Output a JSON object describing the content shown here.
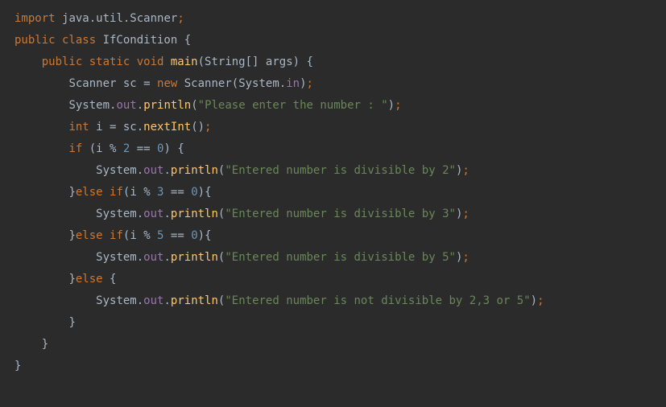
{
  "code": {
    "lines": [
      {
        "indent": 0,
        "tokens": [
          {
            "t": "import ",
            "c": "kw"
          },
          {
            "t": "java.util.Scanner",
            "c": "pkg"
          },
          {
            "t": ";",
            "c": "semi"
          }
        ]
      },
      {
        "indent": 0,
        "tokens": [
          {
            "t": "public class ",
            "c": "kw"
          },
          {
            "t": "IfCondition ",
            "c": "cls"
          },
          {
            "t": "{",
            "c": "brace"
          }
        ]
      },
      {
        "indent": 1,
        "tokens": [
          {
            "t": "public static void ",
            "c": "kw"
          },
          {
            "t": "main",
            "c": "method"
          },
          {
            "t": "(",
            "c": "paren"
          },
          {
            "t": "String",
            "c": "cls"
          },
          {
            "t": "[] ",
            "c": "paren"
          },
          {
            "t": "args",
            "c": "ident"
          },
          {
            "t": ") ",
            "c": "paren"
          },
          {
            "t": "{",
            "c": "brace"
          }
        ]
      },
      {
        "indent": 2,
        "tokens": [
          {
            "t": "Scanner ",
            "c": "cls"
          },
          {
            "t": "sc ",
            "c": "ident"
          },
          {
            "t": "= ",
            "c": "op"
          },
          {
            "t": "new ",
            "c": "kw"
          },
          {
            "t": "Scanner",
            "c": "cls"
          },
          {
            "t": "(",
            "c": "paren"
          },
          {
            "t": "System",
            "c": "cls"
          },
          {
            "t": ".",
            "c": "op"
          },
          {
            "t": "in",
            "c": "field"
          },
          {
            "t": ")",
            "c": "paren"
          },
          {
            "t": ";",
            "c": "semi"
          }
        ]
      },
      {
        "indent": 2,
        "tokens": [
          {
            "t": "System",
            "c": "cls"
          },
          {
            "t": ".",
            "c": "op"
          },
          {
            "t": "out",
            "c": "field"
          },
          {
            "t": ".",
            "c": "op"
          },
          {
            "t": "println",
            "c": "method"
          },
          {
            "t": "(",
            "c": "paren"
          },
          {
            "t": "\"Please enter the number : \"",
            "c": "str"
          },
          {
            "t": ")",
            "c": "paren"
          },
          {
            "t": ";",
            "c": "semi"
          }
        ]
      },
      {
        "indent": 2,
        "tokens": [
          {
            "t": "int ",
            "c": "kw"
          },
          {
            "t": "i ",
            "c": "ident"
          },
          {
            "t": "= ",
            "c": "op"
          },
          {
            "t": "sc",
            "c": "ident"
          },
          {
            "t": ".",
            "c": "op"
          },
          {
            "t": "nextInt",
            "c": "method"
          },
          {
            "t": "()",
            "c": "paren"
          },
          {
            "t": ";",
            "c": "semi"
          }
        ]
      },
      {
        "indent": 2,
        "tokens": [
          {
            "t": "if ",
            "c": "kw"
          },
          {
            "t": "(",
            "c": "paren"
          },
          {
            "t": "i ",
            "c": "ident"
          },
          {
            "t": "% ",
            "c": "op"
          },
          {
            "t": "2",
            "c": "num"
          },
          {
            "t": " == ",
            "c": "op"
          },
          {
            "t": "0",
            "c": "num"
          },
          {
            "t": ") ",
            "c": "paren"
          },
          {
            "t": "{",
            "c": "brace"
          }
        ]
      },
      {
        "indent": 3,
        "tokens": [
          {
            "t": "System",
            "c": "cls"
          },
          {
            "t": ".",
            "c": "op"
          },
          {
            "t": "out",
            "c": "field"
          },
          {
            "t": ".",
            "c": "op"
          },
          {
            "t": "println",
            "c": "method"
          },
          {
            "t": "(",
            "c": "paren"
          },
          {
            "t": "\"Entered number is divisible by 2\"",
            "c": "str"
          },
          {
            "t": ")",
            "c": "paren"
          },
          {
            "t": ";",
            "c": "semi"
          }
        ]
      },
      {
        "indent": 2,
        "tokens": [
          {
            "t": "}",
            "c": "brace"
          },
          {
            "t": "else if",
            "c": "kw"
          },
          {
            "t": "(",
            "c": "paren"
          },
          {
            "t": "i ",
            "c": "ident"
          },
          {
            "t": "% ",
            "c": "op"
          },
          {
            "t": "3",
            "c": "num"
          },
          {
            "t": " == ",
            "c": "op"
          },
          {
            "t": "0",
            "c": "num"
          },
          {
            "t": ")",
            "c": "paren"
          },
          {
            "t": "{",
            "c": "brace"
          }
        ]
      },
      {
        "indent": 3,
        "tokens": [
          {
            "t": "System",
            "c": "cls"
          },
          {
            "t": ".",
            "c": "op"
          },
          {
            "t": "out",
            "c": "field"
          },
          {
            "t": ".",
            "c": "op"
          },
          {
            "t": "println",
            "c": "method"
          },
          {
            "t": "(",
            "c": "paren"
          },
          {
            "t": "\"Entered number is divisible by 3\"",
            "c": "str"
          },
          {
            "t": ")",
            "c": "paren"
          },
          {
            "t": ";",
            "c": "semi"
          }
        ]
      },
      {
        "indent": 2,
        "tokens": [
          {
            "t": "}",
            "c": "brace"
          },
          {
            "t": "else if",
            "c": "kw"
          },
          {
            "t": "(",
            "c": "paren"
          },
          {
            "t": "i ",
            "c": "ident"
          },
          {
            "t": "% ",
            "c": "op"
          },
          {
            "t": "5",
            "c": "num"
          },
          {
            "t": " == ",
            "c": "op"
          },
          {
            "t": "0",
            "c": "num"
          },
          {
            "t": ")",
            "c": "paren"
          },
          {
            "t": "{",
            "c": "brace"
          }
        ]
      },
      {
        "indent": 3,
        "tokens": [
          {
            "t": "System",
            "c": "cls"
          },
          {
            "t": ".",
            "c": "op"
          },
          {
            "t": "out",
            "c": "field"
          },
          {
            "t": ".",
            "c": "op"
          },
          {
            "t": "println",
            "c": "method"
          },
          {
            "t": "(",
            "c": "paren"
          },
          {
            "t": "\"Entered number is divisible by 5\"",
            "c": "str"
          },
          {
            "t": ")",
            "c": "paren"
          },
          {
            "t": ";",
            "c": "semi"
          }
        ]
      },
      {
        "indent": 2,
        "tokens": [
          {
            "t": "}",
            "c": "brace"
          },
          {
            "t": "else ",
            "c": "kw"
          },
          {
            "t": "{",
            "c": "brace"
          }
        ]
      },
      {
        "indent": 3,
        "tokens": [
          {
            "t": "System",
            "c": "cls"
          },
          {
            "t": ".",
            "c": "op"
          },
          {
            "t": "out",
            "c": "field"
          },
          {
            "t": ".",
            "c": "op"
          },
          {
            "t": "println",
            "c": "method"
          },
          {
            "t": "(",
            "c": "paren"
          },
          {
            "t": "\"Entered number is not divisible by 2,3 or 5\"",
            "c": "str"
          },
          {
            "t": ")",
            "c": "paren"
          },
          {
            "t": ";",
            "c": "semi"
          }
        ]
      },
      {
        "indent": 2,
        "tokens": [
          {
            "t": "}",
            "c": "brace"
          }
        ]
      },
      {
        "indent": 1,
        "tokens": [
          {
            "t": "}",
            "c": "brace"
          }
        ]
      },
      {
        "indent": 0,
        "tokens": [
          {
            "t": "}",
            "c": "brace"
          }
        ]
      }
    ]
  },
  "indent_unit": "    "
}
